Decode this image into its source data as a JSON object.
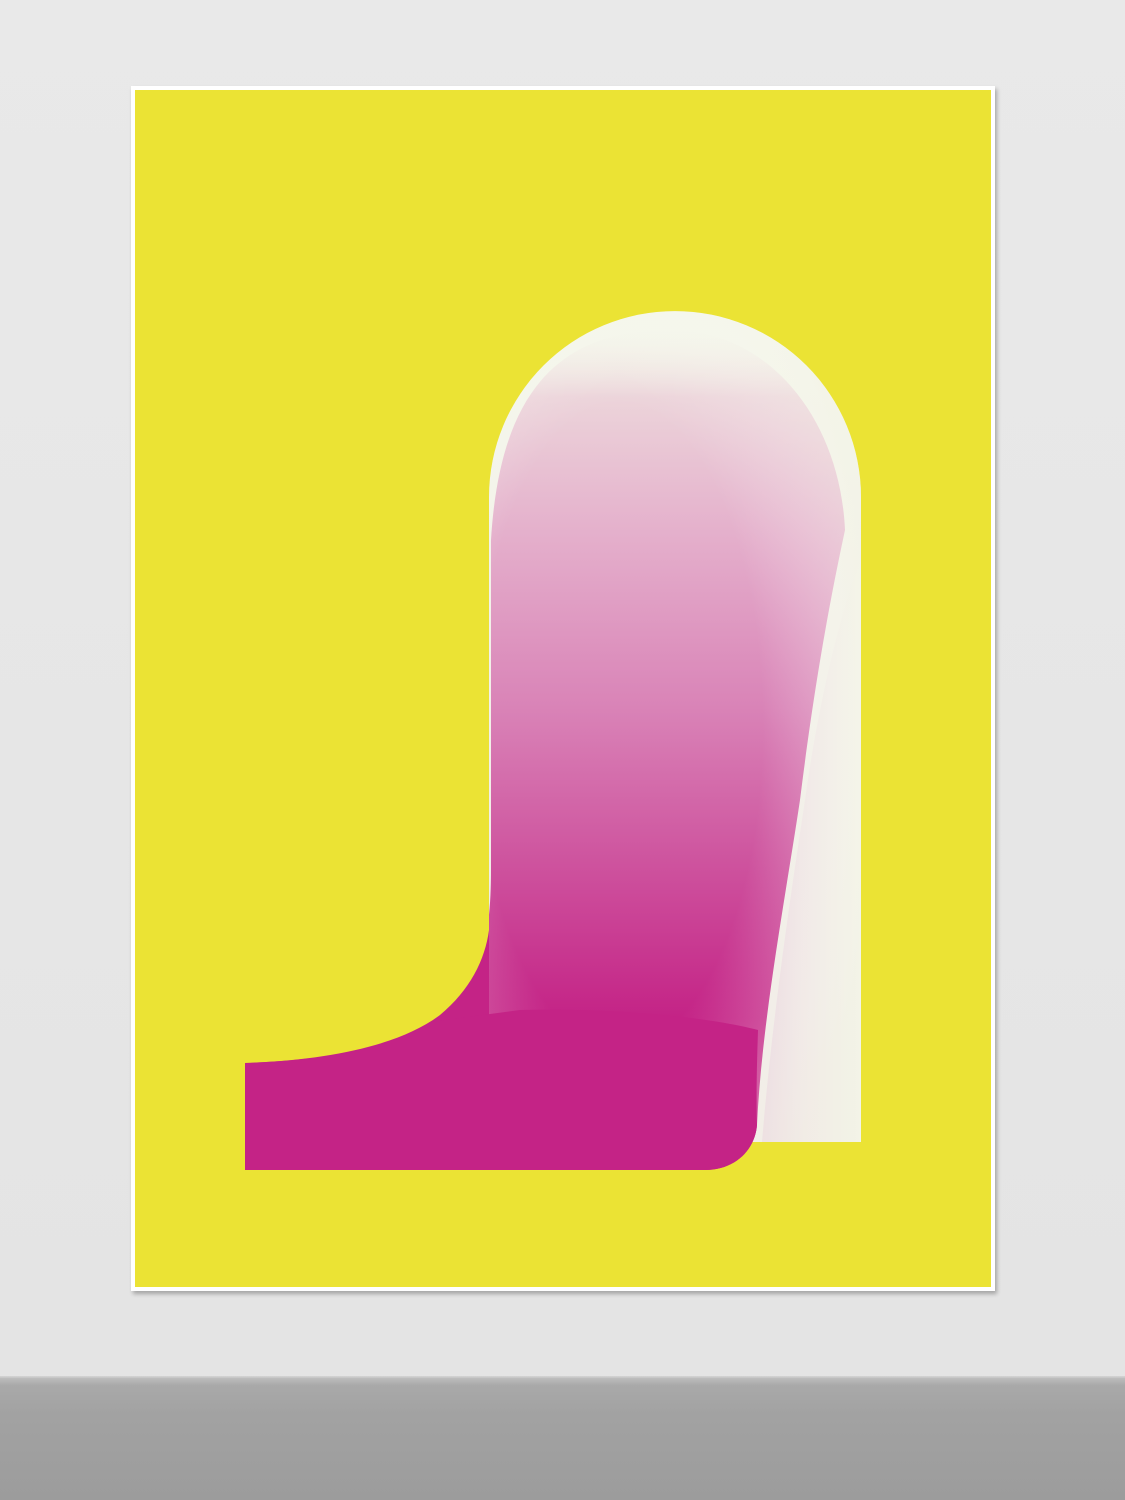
{
  "scene": {
    "description_type": "artwork-on-wall",
    "colors": {
      "wall": "#e7e7e7",
      "floor": "#a2a2a2",
      "frame": "#ffffff",
      "canvas": "#ebe334",
      "arch_light": "#f3f5e8",
      "magenta": "#c42386",
      "pink_mid": "#dc8ab9"
    }
  }
}
